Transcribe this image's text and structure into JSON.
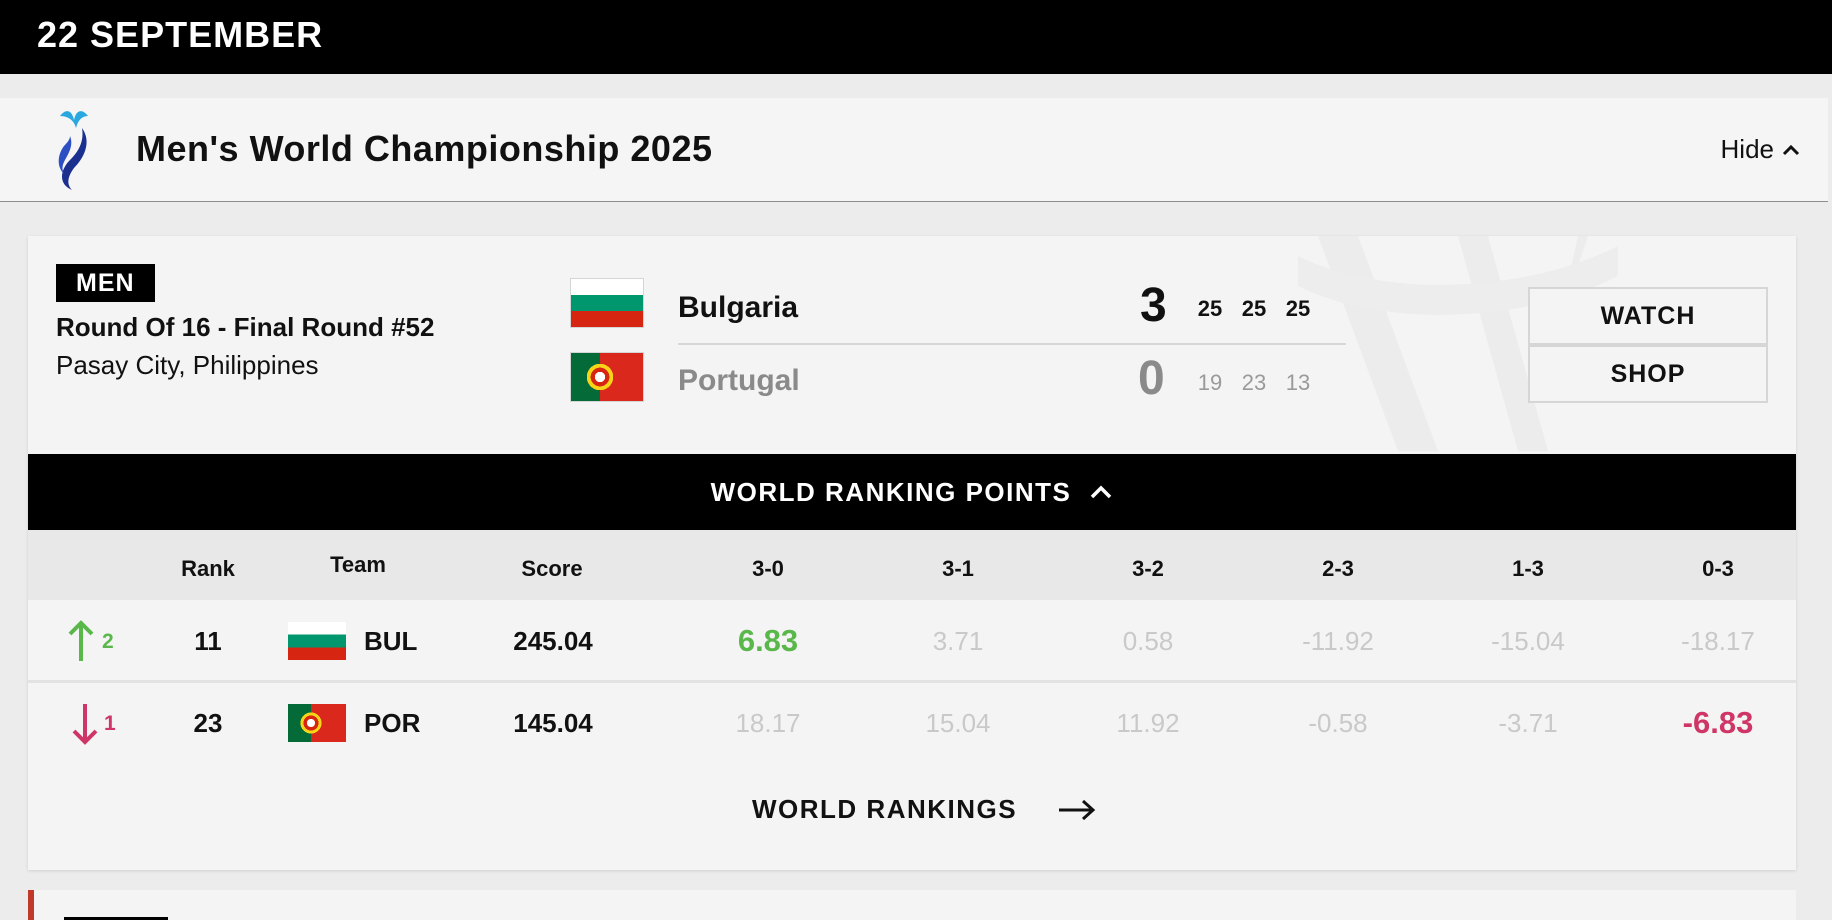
{
  "date_header": "22 SEPTEMBER",
  "competition": {
    "title": "Men's World Championship 2025",
    "hide_label": "Hide"
  },
  "match": {
    "gender": "MEN",
    "round": "Round Of 16 - Final Round #52",
    "venue": "Pasay City, Philippines",
    "home": {
      "name": "Bulgaria",
      "sets": "3",
      "set_scores": [
        "25",
        "25",
        "25"
      ]
    },
    "away": {
      "name": "Portugal",
      "sets": "0",
      "set_scores": [
        "19",
        "23",
        "13"
      ]
    },
    "actions": {
      "watch": "WATCH",
      "shop": "SHOP"
    }
  },
  "world_ranking_points": {
    "title": "WORLD RANKING POINTS",
    "columns": [
      "Rank",
      "Team",
      "Score",
      "3-0",
      "3-1",
      "3-2",
      "2-3",
      "1-3",
      "0-3"
    ],
    "rows": [
      {
        "movement": "up",
        "movement_value": "2",
        "rank": "11",
        "code": "BUL",
        "score": "245.04",
        "points": [
          "6.83",
          "3.71",
          "0.58",
          "-11.92",
          "-15.04",
          "-18.17"
        ]
      },
      {
        "movement": "down",
        "movement_value": "1",
        "rank": "23",
        "code": "POR",
        "score": "145.04",
        "points": [
          "18.17",
          "15.04",
          "11.92",
          "-0.58",
          "-3.71",
          "-6.83"
        ]
      }
    ],
    "link_label": "WORLD RANKINGS"
  },
  "colors": {
    "positive": "#5ab84b",
    "negative": "#cf3567",
    "muted": "#c9c9c9",
    "bar": "#000000"
  }
}
